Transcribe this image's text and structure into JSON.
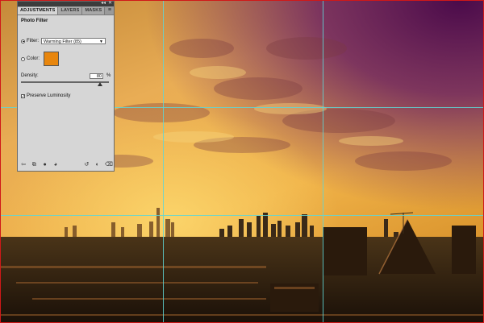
{
  "panel": {
    "tabs": [
      "ADJUSTMENTS",
      "LAYERS",
      "MASKS"
    ],
    "window_controls": {
      "collapse": "◂◂",
      "close": "✕"
    },
    "menu_icon": "panel-menu-icon",
    "title": "Photo Filter",
    "filter_label": "Filter:",
    "filter_value": "Warming Filter (85)",
    "color_label": "Color:",
    "color_swatch": "#e8860d",
    "density_label": "Density:",
    "density_value": "80",
    "density_unit": "%",
    "density_fraction": 0.8,
    "preserve_label": "Preserve Luminosity",
    "preserve_checked": true,
    "toolbar_icons": [
      "back-arrow-icon",
      "clip-to-layer-icon",
      "visibility-eye-icon",
      "view-previous-icon",
      "reset-icon",
      "visibility-toggle-icon",
      "trash-icon"
    ]
  },
  "colors": {
    "guide": "#5fd6d6",
    "canvas_border": "#d01818",
    "sky_top": "#5a1050",
    "sky_warm": "#f0b040"
  }
}
